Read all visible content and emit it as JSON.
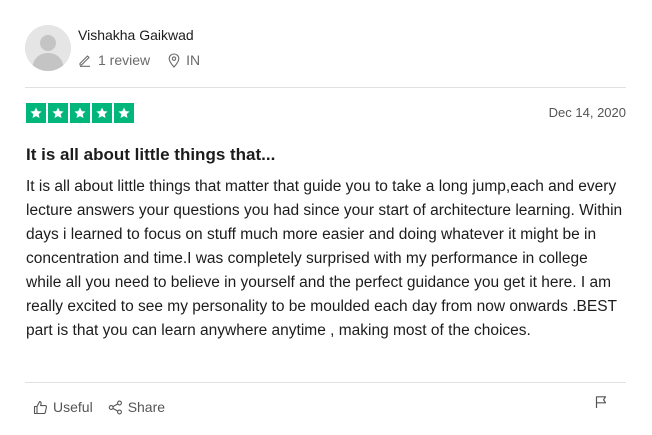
{
  "reviewer": {
    "name": "Vishakha Gaikwad",
    "reviews_count": "1 review",
    "country": "IN"
  },
  "review": {
    "rating": 5,
    "date": "Dec 14, 2020",
    "title": "It is all about little things that...",
    "body": "It is all about little things that matter that guide you to take a long jump,each and every lecture answers your questions you had since your start of architecture learning. Within days i learned to focus on stuff much more easier and doing whatever it might be in concentration and time.I was completely surprised with my performance in college while all you need to believe in yourself and the perfect guidance you get it here. I am really excited to see my personality to be moulded each day from now onwards .BEST part is that you can learn anywhere anytime , making most of the choices."
  },
  "actions": {
    "useful_label": "Useful",
    "share_label": "Share"
  },
  "colors": {
    "star_green": "#00b67a",
    "divider": "#e0e0e0",
    "muted_text": "#6a6a6a"
  },
  "icons": {
    "avatar": "user-silhouette-icon",
    "reviews": "pencil-icon",
    "location": "map-pin-icon",
    "star": "star-icon",
    "useful": "thumbs-up-icon",
    "share": "share-icon",
    "flag": "flag-icon"
  }
}
